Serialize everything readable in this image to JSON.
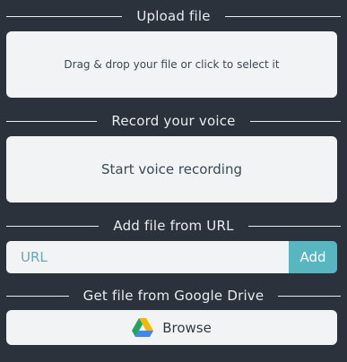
{
  "upload": {
    "title": "Upload file",
    "dropzone_text": "Drag & drop your file or click to select it"
  },
  "record": {
    "title": "Record your voice",
    "button_text": "Start voice recording"
  },
  "url": {
    "title": "Add file from URL",
    "placeholder": "URL",
    "add_label": "Add"
  },
  "drive": {
    "title": "Get file from Google Drive",
    "browse_label": "Browse",
    "icon": "google-drive-icon"
  },
  "colors": {
    "background": "#2b323c",
    "card": "#f2f3f5",
    "accent": "#58b6c1"
  }
}
